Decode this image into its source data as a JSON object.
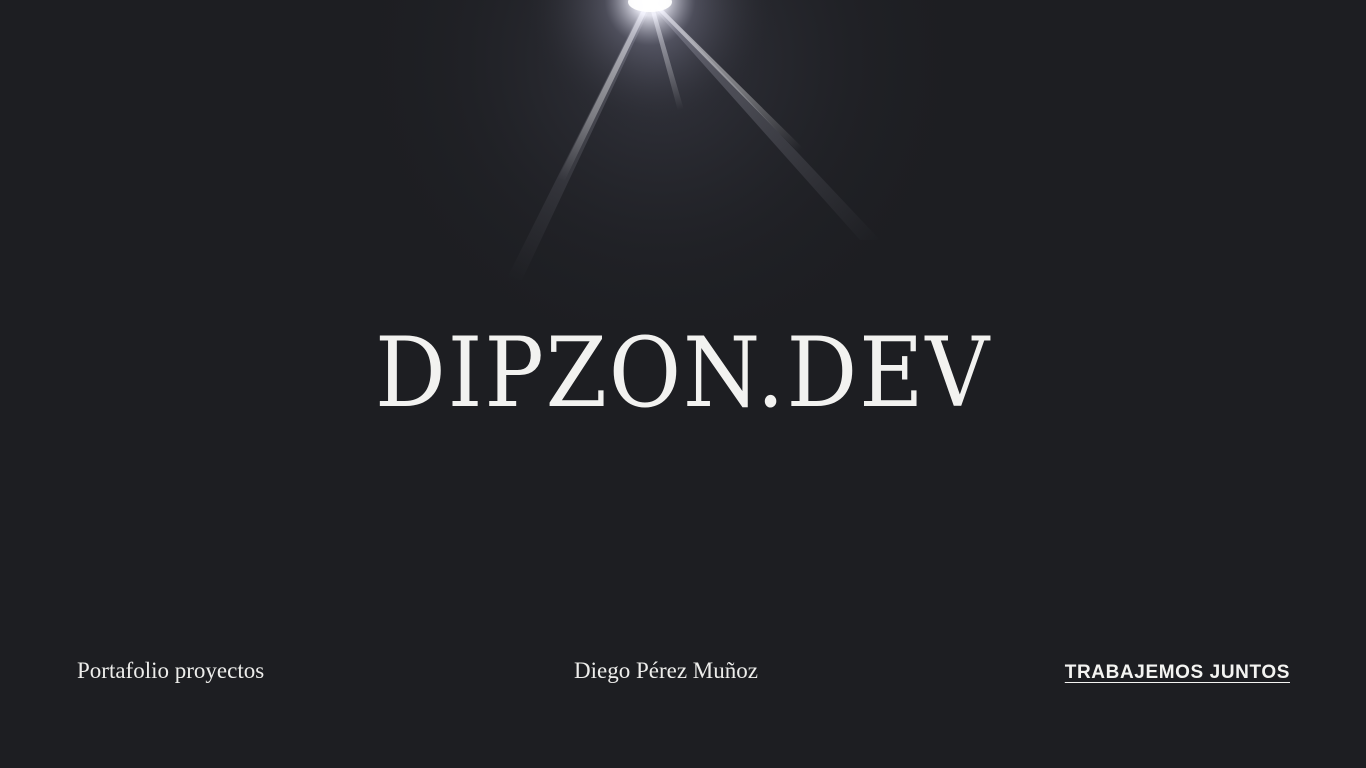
{
  "brand": {
    "title": "DIPZON.DEV"
  },
  "footer": {
    "left_link": "Portafolio proyectos",
    "center_text": "Diego Pérez Muñoz",
    "right_link": "TRABAJEMOS JUNTOS"
  },
  "colors": {
    "background": "#1d1e22",
    "text": "#ededeb",
    "flare": "#ffffff"
  },
  "icons": {
    "flare": "light-flare"
  }
}
